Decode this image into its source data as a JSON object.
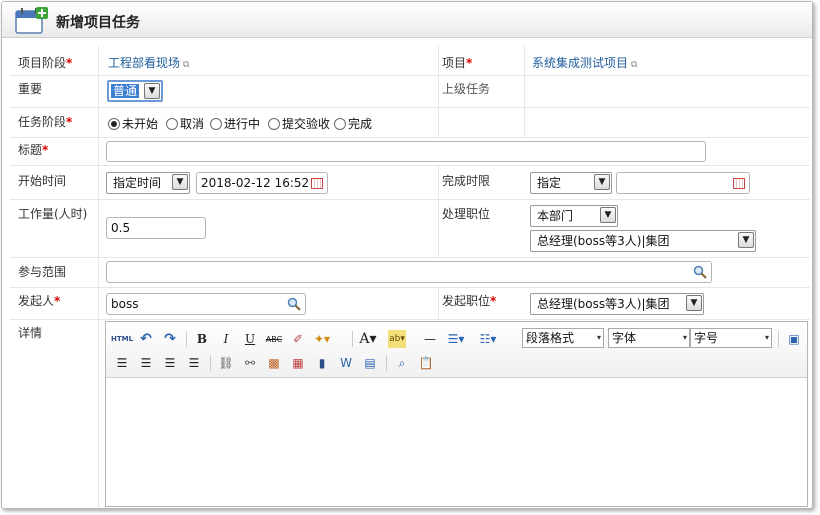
{
  "title": "新增项目任务",
  "fields": {
    "stage_label": "项目阶段",
    "stage_value": "工程部看现场",
    "project_label": "项目",
    "project_value": "系统集成测试项目",
    "importance_label": "重要",
    "importance_value": "普通",
    "parent_task_label": "上级任务",
    "task_stage_label": "任务阶段",
    "task_stage_options": [
      "未开始",
      "取消",
      "进行中",
      "提交验收",
      "完成"
    ],
    "task_stage_selected": "未开始",
    "title_label": "标题",
    "title_value": "",
    "start_label": "开始时间",
    "start_mode": "指定时间",
    "start_value": "2018-02-12 16:52",
    "deadline_label": "完成时限",
    "deadline_mode": "指定",
    "deadline_value": "",
    "workload_label": "工作量(人时)",
    "workload_value": "0.5",
    "handler_label": "处理职位",
    "handler_dept": "本部门",
    "handler_position": "总经理(boss等3人)|集团",
    "scope_label": "参与范围",
    "scope_value": "",
    "initiator_label": "发起人",
    "initiator_value": "boss",
    "initiator_position_label": "发起职位",
    "initiator_position_value": "总经理(boss等3人)|集团",
    "details_label": "详情"
  },
  "editor": {
    "paragraph_format": "段落格式",
    "font": "字体",
    "font_size": "字号",
    "html_label": "HTML"
  },
  "colors": {
    "required": "#dd0000",
    "link": "#1f5d9c",
    "selected_bg": "#3b7fd1"
  }
}
